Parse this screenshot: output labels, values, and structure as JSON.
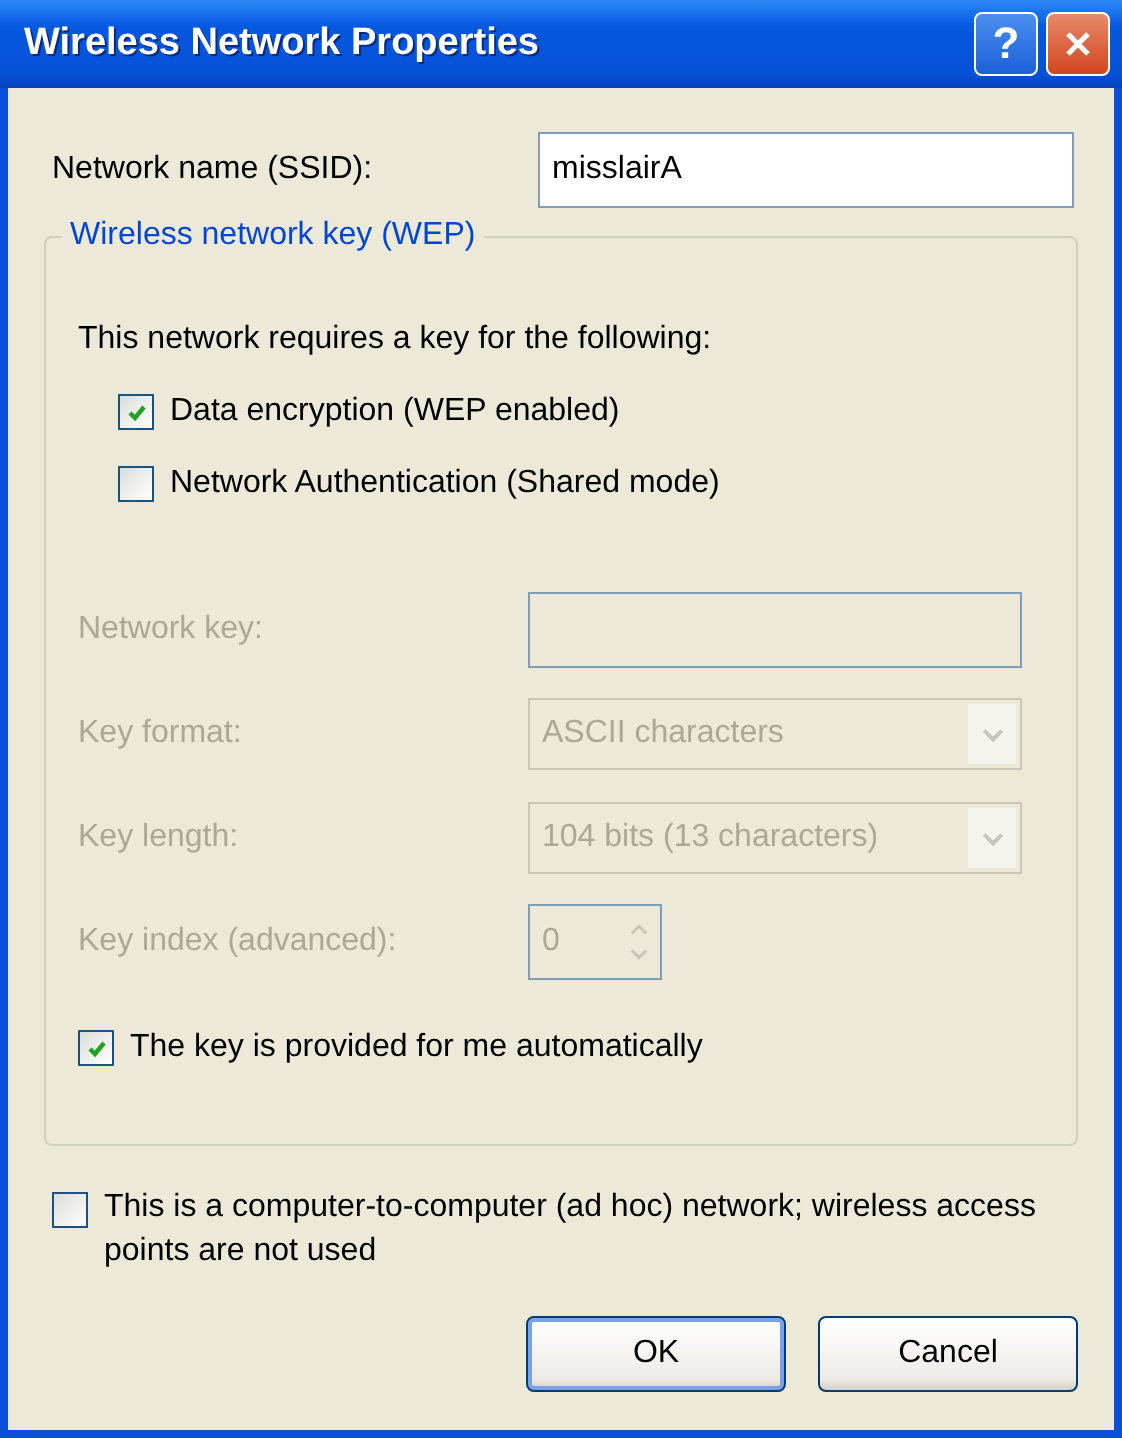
{
  "window": {
    "title": "Wireless Network Properties",
    "help_button": "?"
  },
  "ssid": {
    "label": "Network name (SSID):",
    "value": "misslairA"
  },
  "group": {
    "legend": "Wireless network key (WEP)",
    "intro": "This network requires a key for the following:",
    "options": [
      {
        "label": "Data encryption (WEP enabled)",
        "checked": true
      },
      {
        "label": "Network Authentication (Shared mode)",
        "checked": false
      }
    ],
    "fields": [
      {
        "kind": "text",
        "label": "Network key:",
        "disabled": true
      },
      {
        "kind": "dropdown",
        "label": "Key format:",
        "value": "ASCII characters",
        "disabled": true
      },
      {
        "kind": "dropdown",
        "label": "Key length:",
        "value": "104 bits (13 characters)",
        "disabled": true
      },
      {
        "kind": "spinner",
        "label": "Key index (advanced):",
        "value": "0",
        "disabled": true
      }
    ],
    "auto_key": {
      "label": "The key is provided for me automatically",
      "checked": true
    }
  },
  "adhoc": {
    "label": "This is a computer-to-computer (ad hoc) network; wireless access points are not used",
    "checked": false
  },
  "buttons": [
    {
      "label": "OK",
      "default": true
    },
    {
      "label": "Cancel",
      "default": false
    }
  ]
}
